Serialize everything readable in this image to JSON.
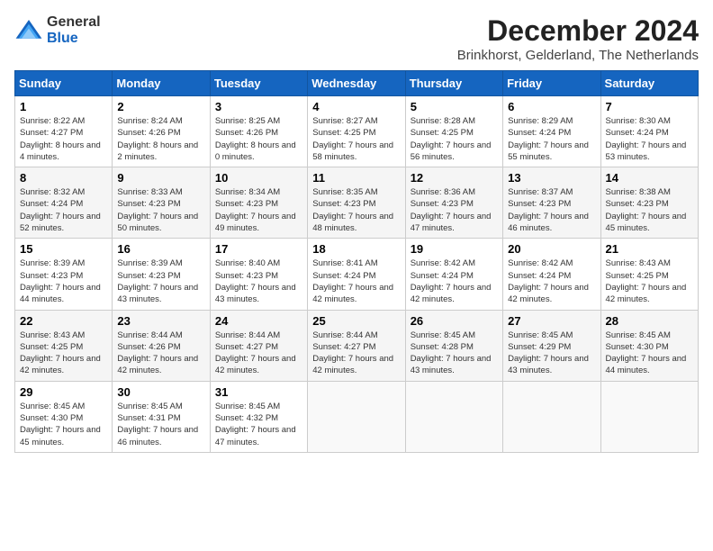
{
  "header": {
    "logo_line1": "General",
    "logo_line2": "Blue",
    "month": "December 2024",
    "location": "Brinkhorst, Gelderland, The Netherlands"
  },
  "days_of_week": [
    "Sunday",
    "Monday",
    "Tuesday",
    "Wednesday",
    "Thursday",
    "Friday",
    "Saturday"
  ],
  "weeks": [
    [
      {
        "day": "1",
        "sunrise": "Sunrise: 8:22 AM",
        "sunset": "Sunset: 4:27 PM",
        "daylight": "Daylight: 8 hours and 4 minutes."
      },
      {
        "day": "2",
        "sunrise": "Sunrise: 8:24 AM",
        "sunset": "Sunset: 4:26 PM",
        "daylight": "Daylight: 8 hours and 2 minutes."
      },
      {
        "day": "3",
        "sunrise": "Sunrise: 8:25 AM",
        "sunset": "Sunset: 4:26 PM",
        "daylight": "Daylight: 8 hours and 0 minutes."
      },
      {
        "day": "4",
        "sunrise": "Sunrise: 8:27 AM",
        "sunset": "Sunset: 4:25 PM",
        "daylight": "Daylight: 7 hours and 58 minutes."
      },
      {
        "day": "5",
        "sunrise": "Sunrise: 8:28 AM",
        "sunset": "Sunset: 4:25 PM",
        "daylight": "Daylight: 7 hours and 56 minutes."
      },
      {
        "day": "6",
        "sunrise": "Sunrise: 8:29 AM",
        "sunset": "Sunset: 4:24 PM",
        "daylight": "Daylight: 7 hours and 55 minutes."
      },
      {
        "day": "7",
        "sunrise": "Sunrise: 8:30 AM",
        "sunset": "Sunset: 4:24 PM",
        "daylight": "Daylight: 7 hours and 53 minutes."
      }
    ],
    [
      {
        "day": "8",
        "sunrise": "Sunrise: 8:32 AM",
        "sunset": "Sunset: 4:24 PM",
        "daylight": "Daylight: 7 hours and 52 minutes."
      },
      {
        "day": "9",
        "sunrise": "Sunrise: 8:33 AM",
        "sunset": "Sunset: 4:23 PM",
        "daylight": "Daylight: 7 hours and 50 minutes."
      },
      {
        "day": "10",
        "sunrise": "Sunrise: 8:34 AM",
        "sunset": "Sunset: 4:23 PM",
        "daylight": "Daylight: 7 hours and 49 minutes."
      },
      {
        "day": "11",
        "sunrise": "Sunrise: 8:35 AM",
        "sunset": "Sunset: 4:23 PM",
        "daylight": "Daylight: 7 hours and 48 minutes."
      },
      {
        "day": "12",
        "sunrise": "Sunrise: 8:36 AM",
        "sunset": "Sunset: 4:23 PM",
        "daylight": "Daylight: 7 hours and 47 minutes."
      },
      {
        "day": "13",
        "sunrise": "Sunrise: 8:37 AM",
        "sunset": "Sunset: 4:23 PM",
        "daylight": "Daylight: 7 hours and 46 minutes."
      },
      {
        "day": "14",
        "sunrise": "Sunrise: 8:38 AM",
        "sunset": "Sunset: 4:23 PM",
        "daylight": "Daylight: 7 hours and 45 minutes."
      }
    ],
    [
      {
        "day": "15",
        "sunrise": "Sunrise: 8:39 AM",
        "sunset": "Sunset: 4:23 PM",
        "daylight": "Daylight: 7 hours and 44 minutes."
      },
      {
        "day": "16",
        "sunrise": "Sunrise: 8:39 AM",
        "sunset": "Sunset: 4:23 PM",
        "daylight": "Daylight: 7 hours and 43 minutes."
      },
      {
        "day": "17",
        "sunrise": "Sunrise: 8:40 AM",
        "sunset": "Sunset: 4:23 PM",
        "daylight": "Daylight: 7 hours and 43 minutes."
      },
      {
        "day": "18",
        "sunrise": "Sunrise: 8:41 AM",
        "sunset": "Sunset: 4:24 PM",
        "daylight": "Daylight: 7 hours and 42 minutes."
      },
      {
        "day": "19",
        "sunrise": "Sunrise: 8:42 AM",
        "sunset": "Sunset: 4:24 PM",
        "daylight": "Daylight: 7 hours and 42 minutes."
      },
      {
        "day": "20",
        "sunrise": "Sunrise: 8:42 AM",
        "sunset": "Sunset: 4:24 PM",
        "daylight": "Daylight: 7 hours and 42 minutes."
      },
      {
        "day": "21",
        "sunrise": "Sunrise: 8:43 AM",
        "sunset": "Sunset: 4:25 PM",
        "daylight": "Daylight: 7 hours and 42 minutes."
      }
    ],
    [
      {
        "day": "22",
        "sunrise": "Sunrise: 8:43 AM",
        "sunset": "Sunset: 4:25 PM",
        "daylight": "Daylight: 7 hours and 42 minutes."
      },
      {
        "day": "23",
        "sunrise": "Sunrise: 8:44 AM",
        "sunset": "Sunset: 4:26 PM",
        "daylight": "Daylight: 7 hours and 42 minutes."
      },
      {
        "day": "24",
        "sunrise": "Sunrise: 8:44 AM",
        "sunset": "Sunset: 4:27 PM",
        "daylight": "Daylight: 7 hours and 42 minutes."
      },
      {
        "day": "25",
        "sunrise": "Sunrise: 8:44 AM",
        "sunset": "Sunset: 4:27 PM",
        "daylight": "Daylight: 7 hours and 42 minutes."
      },
      {
        "day": "26",
        "sunrise": "Sunrise: 8:45 AM",
        "sunset": "Sunset: 4:28 PM",
        "daylight": "Daylight: 7 hours and 43 minutes."
      },
      {
        "day": "27",
        "sunrise": "Sunrise: 8:45 AM",
        "sunset": "Sunset: 4:29 PM",
        "daylight": "Daylight: 7 hours and 43 minutes."
      },
      {
        "day": "28",
        "sunrise": "Sunrise: 8:45 AM",
        "sunset": "Sunset: 4:30 PM",
        "daylight": "Daylight: 7 hours and 44 minutes."
      }
    ],
    [
      {
        "day": "29",
        "sunrise": "Sunrise: 8:45 AM",
        "sunset": "Sunset: 4:30 PM",
        "daylight": "Daylight: 7 hours and 45 minutes."
      },
      {
        "day": "30",
        "sunrise": "Sunrise: 8:45 AM",
        "sunset": "Sunset: 4:31 PM",
        "daylight": "Daylight: 7 hours and 46 minutes."
      },
      {
        "day": "31",
        "sunrise": "Sunrise: 8:45 AM",
        "sunset": "Sunset: 4:32 PM",
        "daylight": "Daylight: 7 hours and 47 minutes."
      },
      null,
      null,
      null,
      null
    ]
  ]
}
